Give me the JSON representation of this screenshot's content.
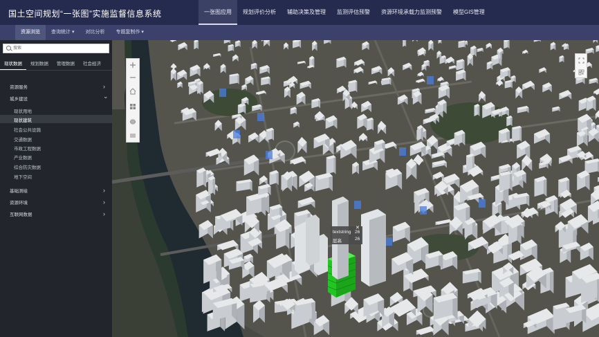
{
  "app": {
    "title": "国土空间规划“一张图”实施监督信息系统"
  },
  "top_nav": [
    {
      "label": "一张图应用",
      "active": true
    },
    {
      "label": "规划评价分析"
    },
    {
      "label": "辅助决策及管理"
    },
    {
      "label": "监测评估预警"
    },
    {
      "label": "资源环境承载力监测预警"
    },
    {
      "label": "模型GIS管理"
    }
  ],
  "sub_nav": [
    {
      "label": "资源浏览",
      "active": true
    },
    {
      "label": "查询统计 ▾"
    },
    {
      "label": "对比分析"
    },
    {
      "label": "专题复制作 ▾"
    }
  ],
  "sidebar": {
    "search": {
      "placeholder": "搜索"
    },
    "tabs": [
      {
        "label": "现状数据",
        "active": true
      },
      {
        "label": "规划数据"
      },
      {
        "label": "管理数据"
      },
      {
        "label": "社会经济"
      }
    ],
    "tree": {
      "resource": {
        "label": "资源服务",
        "chevron": "›"
      },
      "city": {
        "label": "城乡建设",
        "chevron": "⌄"
      },
      "city_items": [
        {
          "label": "现状用地"
        },
        {
          "label": "现状建筑",
          "selected": true
        },
        {
          "label": "社会公共设施"
        },
        {
          "label": "交通数据"
        },
        {
          "label": "市政工程数据"
        },
        {
          "label": "产业数据"
        },
        {
          "label": "综合防灾数据"
        },
        {
          "label": "地下空间"
        }
      ],
      "basic": {
        "label": "基础测绘",
        "chevron": "›"
      },
      "env": {
        "label": "资源环境",
        "chevron": "›"
      },
      "internet": {
        "label": "互联网数据",
        "chevron": "›"
      }
    }
  },
  "map": {
    "icons": {
      "zoom_in": "plus-icon",
      "zoom_out": "minus-icon",
      "home": "home-icon",
      "grid": "grid-icon",
      "globe": "globe-icon",
      "layers": "layers-icon",
      "fullscreen": "fullscreen-icon",
      "qr": "qrcode-icon"
    },
    "colors": {
      "highlight": "#1fd21f",
      "building": "#dfe3e6",
      "marker": "#4a7fe0"
    }
  },
  "popup": {
    "row1_label": "textstring",
    "row1_value": "26",
    "row2_label": "层高",
    "row2_value": "26",
    "close": "✕"
  }
}
